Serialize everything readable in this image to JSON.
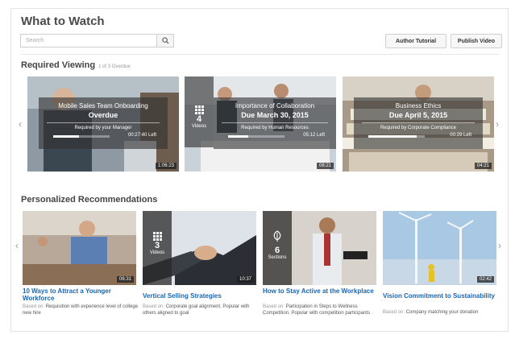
{
  "header": {
    "title": "What to Watch",
    "search_placeholder": "Search",
    "author_tutorial": "Author Tutorial",
    "publish_video": "Publish Video"
  },
  "required": {
    "title": "Required Viewing",
    "subtitle": "1 of 3 Overdue",
    "cards": [
      {
        "title": "Mobile Sales Team Onboarding",
        "status": "Overdue",
        "required_by": "Required by your Manager",
        "time_left": "00:27:40 Left",
        "progress": 0.45,
        "duration": "1:06:23"
      },
      {
        "title": "Importance of Collaboration",
        "status": "Due March 30, 2015",
        "required_by": "Required by Human Resources",
        "time_left": "05:12 Left",
        "progress": 0.35,
        "duration": "08:21",
        "badge_num": "4",
        "badge_label": "Videos"
      },
      {
        "title": "Business Ethics",
        "status": "Due April 5, 2015",
        "required_by": "Required by Corporate Compliance",
        "time_left": "00:29 Left",
        "progress": 0.85,
        "duration": "04:21"
      }
    ]
  },
  "recommendations": {
    "title": "Personalized Recommendations",
    "based_on_label": "Based on:",
    "items": [
      {
        "title": "10 Ways to Attract a Younger Workforce",
        "based_on": "Requisition with experience level of college new hire",
        "duration": "06:31"
      },
      {
        "title": "Vertical Selling Strategies",
        "based_on": "Corporate goal alignment. Popular with others aligned to goal",
        "duration": "10:37",
        "badge_num": "3",
        "badge_label": "Videos"
      },
      {
        "title": "How to Stay Active at the Workplace",
        "based_on": "Participation in Steps to Wellness Competition. Popular with competition participants",
        "badge_num": "6",
        "badge_label": "Sections"
      },
      {
        "title": "Vision Commitment to Sustainability",
        "based_on": "Company matching your donation",
        "duration": "02:42"
      }
    ]
  },
  "colors": {
    "link": "#1a66b3",
    "overlay": "#323232"
  }
}
